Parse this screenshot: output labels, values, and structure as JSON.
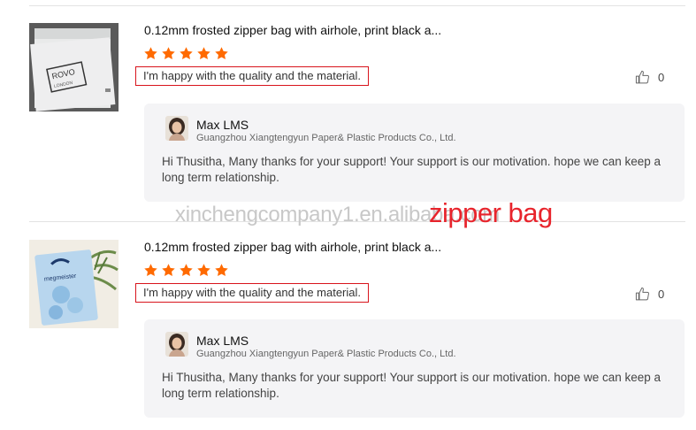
{
  "reviews": [
    {
      "product_title": "0.12mm frosted zipper bag with airhole, print black a...",
      "rating": 5,
      "comment": "I'm happy with the quality and the material.",
      "like_count": "0",
      "reply": {
        "seller_name": "Max LMS",
        "company": "Guangzhou Xiangtengyun Paper& Plastic Products Co., Ltd.",
        "text": "Hi Thusitha, Many thanks for your support! Your support is our motivation. hope we can keep a long term relationship."
      },
      "thumbnail_icon": "frosted-bag-photo"
    },
    {
      "product_title": "0.12mm frosted zipper bag with airhole, print black a...",
      "rating": 5,
      "comment": "I'm happy with the quality and the material.",
      "like_count": "0",
      "reply": {
        "seller_name": "Max LMS",
        "company": "Guangzhou Xiangtengyun Paper& Plastic Products Co., Ltd.",
        "text": "Hi Thusitha, Many thanks for your support! Your support is our motivation. hope we can keep a long term relationship."
      },
      "thumbnail_icon": "blue-bag-photo"
    }
  ],
  "watermark": "xinchengcompany1.en.alibaba.com",
  "overlay_caption": "zipper bag",
  "colors": {
    "star": "#ff6a00",
    "highlight_border": "#d8141c",
    "overlay_text": "#e8242c"
  }
}
